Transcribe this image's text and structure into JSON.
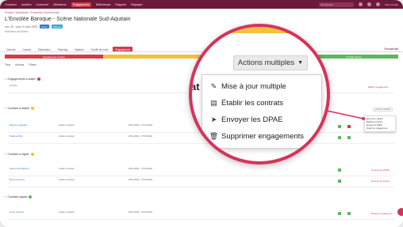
{
  "topbar": {
    "nav": [
      "Compteur",
      "Activités",
      "Document",
      "Utilisateurs",
      "Engagements",
      "Bibliothèque",
      "Rapports",
      "Réglages"
    ],
    "active_index": 4,
    "search_placeholder": "Rechercher",
    "user": "Mon compte"
  },
  "breadcrumb": "Projets / Spectacles / Ensemble Accordonnay",
  "page": {
    "title": "L'Envolée Baroque - Scène Nationale Sud-Aquitain",
    "subtitle": "ven. 26 - sam. 3 mars 2023",
    "badge1": "Prévu",
    "badge2": "Diffusion",
    "venue": "Monstreux-les-Bains"
  },
  "tabs": [
    "Général",
    "Contrat",
    "Distribution",
    "Planning",
    "Matériel",
    "Feuille de route",
    "Engagement"
  ],
  "active_tab": 6,
  "tab_right": "Récapitulatif",
  "status_strips": [
    "Engagements à traiter",
    "",
    "",
    "Contrats signés"
  ],
  "filters": [
    "Tous",
    "Actions",
    "Filtres"
  ],
  "sections": [
    {
      "label": "Engagements à traiter",
      "color": "#d23b4a"
    },
    {
      "label": "Contrats à établir",
      "color": "#f2c23b"
    },
    {
      "label": "Contrats à signer",
      "color": "#f2c23b"
    },
    {
      "label": "Contrats signés",
      "color": "#5cb85c"
    }
  ],
  "rows": [
    {
      "name": "Art Nico",
      "fonction": "",
      "dates": "",
      "action": "Établir l'engagement"
    },
    {
      "name": "Maurice Legendre",
      "fonction": "Artiste musicien",
      "dates": "26/11/2022 · 27/11/2022",
      "action": ""
    },
    {
      "name": "Marlène Brun",
      "fonction": "Artiste musicien",
      "dates": "26/11/2022 · 27/11/2022",
      "action": ""
    },
    {
      "name": "Jean-Louis Marchal",
      "fonction": "Artiste musicien",
      "dates": "26/11/2022 · 27/11/2022",
      "action": "Générer les DPAE"
    },
    {
      "name": "Bruno Lebreton",
      "fonction": "Artiste musicien",
      "dates": "26/11/2022 · 27/11/2022",
      "action": "Générer le contrat"
    },
    {
      "name": "Annie Fournier",
      "fonction": "Artiste musicien",
      "dates": "26/11/2022 · 27/11/2022",
      "action": "Relance engagement"
    }
  ],
  "mini_menu": [
    "Mise à jour multiple",
    "Établir les contrats",
    "Envoyer les DPAE",
    "Supprimer engagements"
  ],
  "magnifier": {
    "behind_text": "at    Ac",
    "button_label": "Actions multiples",
    "items": [
      {
        "icon": "pencil-icon",
        "glyph": "✎",
        "label": "Mise à jour multiple"
      },
      {
        "icon": "document-icon",
        "glyph": "▤",
        "label": "Établir les contrats"
      },
      {
        "icon": "paper-plane-icon",
        "glyph": "➤",
        "label": "Envoyer les DPAE"
      },
      {
        "icon": "trash-icon",
        "glyph": "🗑",
        "label": "Supprimer engagements"
      }
    ]
  },
  "colors": {
    "brand": "#6c1a39",
    "accent": "#d8325a",
    "red": "#d23b4a",
    "yellow": "#f2c23b",
    "green": "#5cb85c"
  }
}
